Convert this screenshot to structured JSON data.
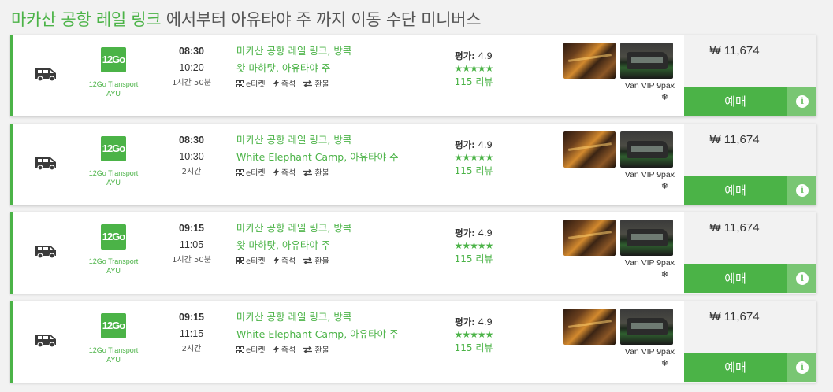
{
  "header": {
    "route_part": "마카산 공항 레일 링크",
    "rest_part": " 에서부터 아유타야 주 까지 이동 수단 미니버스"
  },
  "labels": {
    "eticket": "e티켓",
    "instant": "즉석",
    "refund": "환불",
    "rating_label": "평가:",
    "book": "예매",
    "info": "i",
    "stars": "★★★★★",
    "snowflake": "❄"
  },
  "icons": {
    "transport": "van-icon",
    "eticket": "qr-code-icon",
    "instant": "lightning-icon",
    "refund": "exchange-arrows-icon",
    "info": "info-circle-icon",
    "aircon": "snowflake-icon"
  },
  "colors": {
    "accent": "#4bb347",
    "info_button": "#79c673"
  },
  "trips": [
    {
      "operator": "12Go Transport AYU",
      "logo_text": "12Go",
      "depart": "08:30",
      "arrive": "10:20",
      "duration": "1시간 50분",
      "from": "마카산 공항 레일 링크, 방콕",
      "to": "왓 마하탓, 아유타야 주",
      "rating": "4.9",
      "reviews": "115 리뷰",
      "vehicle": "Van VIP 9pax",
      "price": "₩ 11,674"
    },
    {
      "operator": "12Go Transport AYU",
      "logo_text": "12Go",
      "depart": "08:30",
      "arrive": "10:30",
      "duration": "2시간",
      "from": "마카산 공항 레일 링크, 방콕",
      "to": "White Elephant Camp, 아유타야 주",
      "rating": "4.9",
      "reviews": "115 리뷰",
      "vehicle": "Van VIP 9pax",
      "price": "₩ 11,674"
    },
    {
      "operator": "12Go Transport AYU",
      "logo_text": "12Go",
      "depart": "09:15",
      "arrive": "11:05",
      "duration": "1시간 50분",
      "from": "마카산 공항 레일 링크, 방콕",
      "to": "왓 마하탓, 아유타야 주",
      "rating": "4.9",
      "reviews": "115 리뷰",
      "vehicle": "Van VIP 9pax",
      "price": "₩ 11,674"
    },
    {
      "operator": "12Go Transport AYU",
      "logo_text": "12Go",
      "depart": "09:15",
      "arrive": "11:15",
      "duration": "2시간",
      "from": "마카산 공항 레일 링크, 방콕",
      "to": "White Elephant Camp, 아유타야 주",
      "rating": "4.9",
      "reviews": "115 리뷰",
      "vehicle": "Van VIP 9pax",
      "price": "₩ 11,674"
    }
  ]
}
